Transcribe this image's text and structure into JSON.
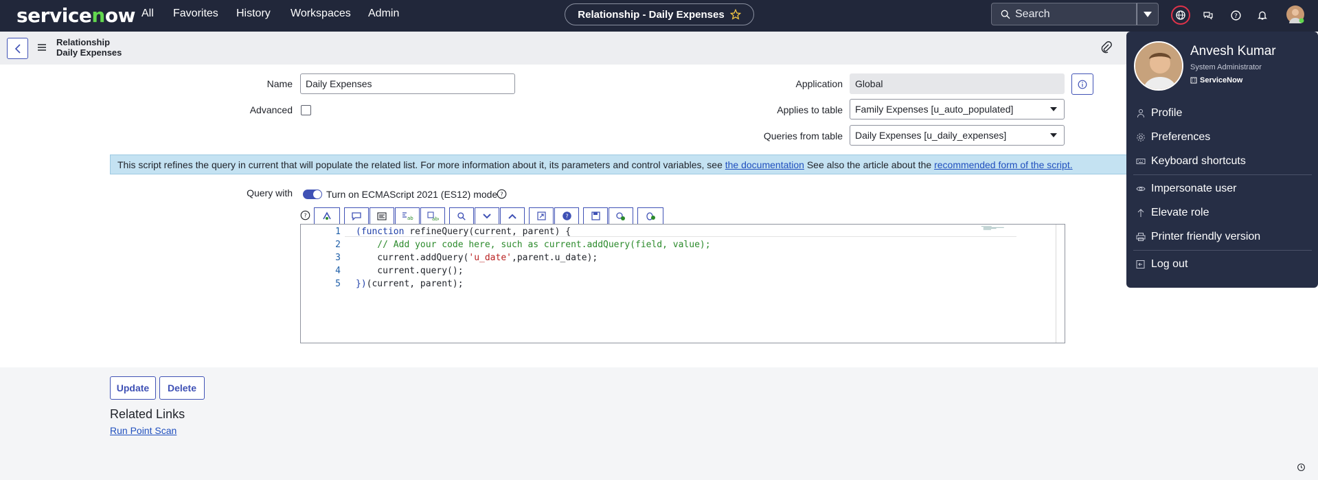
{
  "topbar": {
    "logo": "servicenow",
    "nav": [
      "All",
      "Favorites",
      "History",
      "Workspaces",
      "Admin"
    ],
    "title": "Relationship - Daily Expenses",
    "search_label": "Search"
  },
  "subbar": {
    "crumb_line1": "Relationship",
    "crumb_line2": "Daily Expenses"
  },
  "form": {
    "name_label": "Name",
    "name_value": "Daily Expenses",
    "advanced_label": "Advanced",
    "application_label": "Application",
    "application_value": "Global",
    "applies_label": "Applies to table",
    "applies_value": "Family Expenses [u_auto_populated]",
    "queries_label": "Queries from table",
    "queries_value": "Daily Expenses [u_daily_expenses]",
    "banner_prefix": "This script refines the query in current that will populate the related list. For more information about it, its parameters and control variables, see ",
    "banner_link1": "the documentation",
    "banner_middle": " See also the article about the ",
    "banner_link2": "recommended form of the script.",
    "query_with_label": "Query with",
    "ecma_label": "Turn on ECMAScript 2021 (ES12) mode"
  },
  "code": {
    "line_numbers": [
      "1",
      "2",
      "3",
      "4",
      "5"
    ],
    "l1_kw": "(function",
    "l1_rest": " refineQuery(current, parent) {",
    "l2": "    // Add your code here, such as current.addQuery(field, value);",
    "l3_a": "    current.addQuery(",
    "l3_str": "'u_date'",
    "l3_b": ",parent.u_date);",
    "l4": "    current.query();",
    "l5_kw": "})",
    "l5_rest": "(current, parent);"
  },
  "actions": {
    "update": "Update",
    "delete": "Delete",
    "related_title": "Related Links",
    "related_link": "Run Point Scan"
  },
  "user_menu": {
    "name": "Anvesh Kumar",
    "role": "System Administrator",
    "company": "ServiceNow",
    "items": [
      "Profile",
      "Preferences",
      "Keyboard shortcuts",
      "Impersonate user",
      "Elevate role",
      "Printer friendly version",
      "Log out"
    ]
  },
  "colors": {
    "topbar": "#21273a",
    "accent": "#3f51b5",
    "banner": "#c4e2f2",
    "menu": "#262e45"
  }
}
